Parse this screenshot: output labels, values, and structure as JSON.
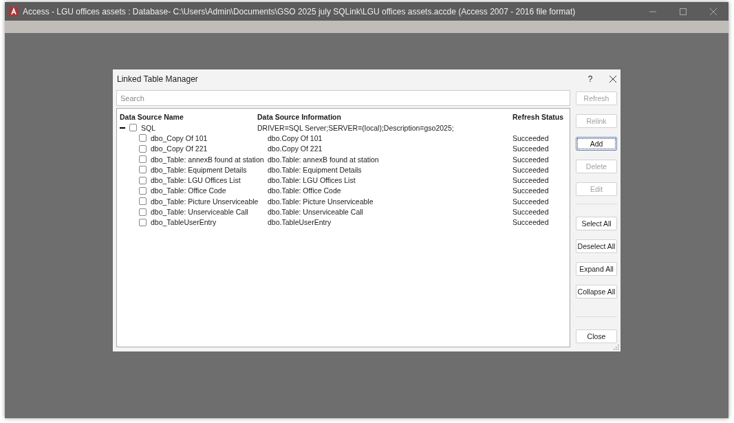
{
  "window": {
    "title": "Access - LGU offices assets : Database- C:\\Users\\Admin\\Documents\\GSO 2025 july SQLink\\LGU offices assets.accde (Access 2007 - 2016 file format)"
  },
  "dialog": {
    "title": "Linked Table Manager",
    "help": "?",
    "search": {
      "placeholder": "Search"
    },
    "columns": [
      "Data Source Name",
      "Data Source Information",
      "Refresh Status"
    ],
    "data_sources": [
      {
        "name": "SQL",
        "info": "DRIVER=SQL Server;SERVER=(local);Description=gso2025;",
        "expanded": true,
        "checked": false,
        "children": [
          {
            "name": "dbo_Copy Of 101",
            "info": "dbo.Copy Of 101",
            "status": "Succeeded",
            "checked": false
          },
          {
            "name": "dbo_Copy Of 221",
            "info": "dbo.Copy Of 221",
            "status": "Succeeded",
            "checked": false
          },
          {
            "name": "dbo_Table: annexB found at station",
            "info": "dbo.Table: annexB found at station",
            "status": "Succeeded",
            "checked": false
          },
          {
            "name": "dbo_Table: Equipment Details",
            "info": "dbo.Table: Equipment Details",
            "status": "Succeeded",
            "checked": false
          },
          {
            "name": "dbo_Table: LGU Offices List",
            "info": "dbo.Table: LGU Offices List",
            "status": "Succeeded",
            "checked": false
          },
          {
            "name": "dbo_Table: Office Code",
            "info": "dbo.Table: Office Code",
            "status": "Succeeded",
            "checked": false
          },
          {
            "name": "dbo_Table: Picture Unserviceable",
            "info": "dbo.Table: Picture Unserviceable",
            "status": "Succeeded",
            "checked": false
          },
          {
            "name": "dbo_Table: Unserviceable Call",
            "info": "dbo.Table: Unserviceable Call",
            "status": "Succeeded",
            "checked": false
          },
          {
            "name": "dbo_TableUserEntry",
            "info": "dbo.TableUserEntry",
            "status": "Succeeded",
            "checked": false
          }
        ]
      }
    ],
    "button_groups": [
      [
        {
          "label": "Refresh",
          "disabled": true,
          "default": false
        },
        {
          "label": "Relink",
          "disabled": true,
          "default": false
        },
        {
          "label": "Add",
          "disabled": false,
          "default": true
        },
        {
          "label": "Delete",
          "disabled": true,
          "default": false
        },
        {
          "label": "Edit",
          "disabled": true,
          "default": false
        }
      ],
      [
        {
          "label": "Select All",
          "disabled": false,
          "default": false
        },
        {
          "label": "Deselect All",
          "disabled": false,
          "default": false
        },
        {
          "label": "Expand All",
          "disabled": false,
          "default": false
        },
        {
          "label": "Collapse All",
          "disabled": false,
          "default": false
        }
      ],
      [
        {
          "label": "Close",
          "disabled": false,
          "default": false
        }
      ]
    ]
  }
}
